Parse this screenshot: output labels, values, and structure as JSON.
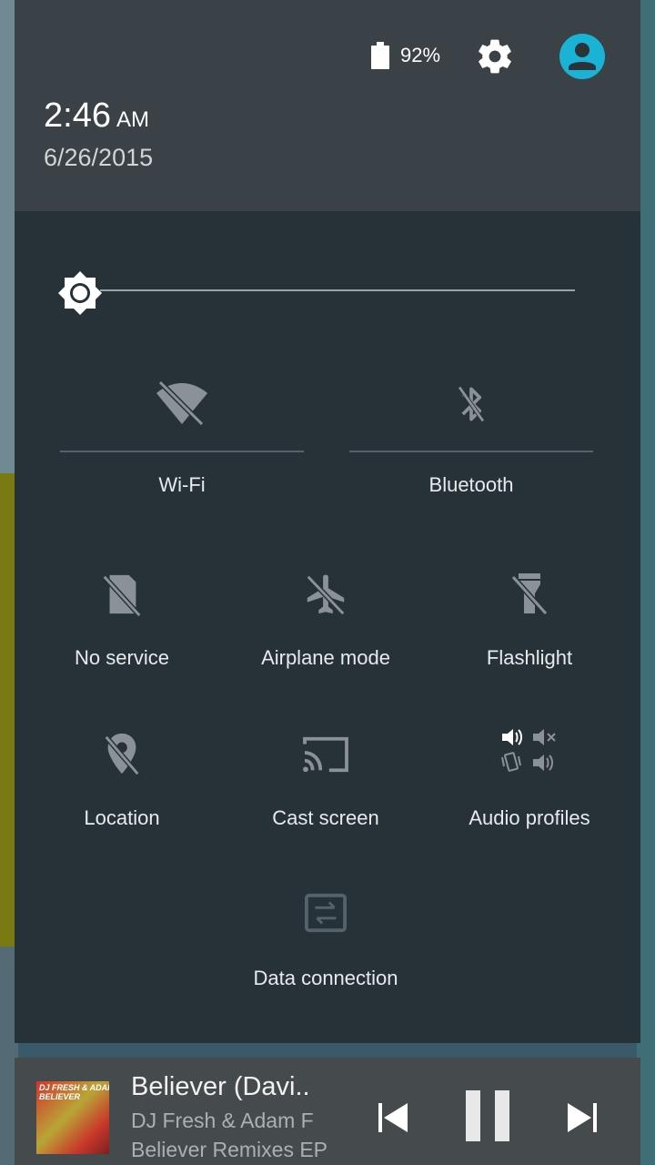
{
  "status": {
    "battery_percent": "92%"
  },
  "header": {
    "time": "2:46",
    "ampm": "AM",
    "date": "6/26/2015"
  },
  "quick_settings": {
    "brightness_level": 0.0,
    "large_tiles": [
      {
        "label": "Wi-Fi",
        "icon": "wifi-off-icon",
        "state": "off"
      },
      {
        "label": "Bluetooth",
        "icon": "bluetooth-off-icon",
        "state": "off"
      }
    ],
    "tiles": [
      {
        "label": "No service",
        "icon": "sim-off-icon"
      },
      {
        "label": "Airplane mode",
        "icon": "airplane-off-icon"
      },
      {
        "label": "Flashlight",
        "icon": "flashlight-off-icon"
      },
      {
        "label": "Location",
        "icon": "location-off-icon"
      },
      {
        "label": "Cast screen",
        "icon": "cast-icon"
      },
      {
        "label": "Audio profiles",
        "icon": "audio-profiles-icon"
      },
      {
        "label": "Data connection",
        "icon": "data-connection-icon"
      }
    ]
  },
  "media": {
    "album_art_text_1": "DJ FRESH & ADAM F",
    "album_art_text_2": "BELIEVER",
    "title": "Believer (Davi..",
    "artist": "DJ Fresh & Adam F",
    "album": "Believer Remixes EP"
  },
  "colors": {
    "header_bg": "#3a4147",
    "panel_bg": "#263238",
    "accent": "#1ab3d6",
    "media_bg": "#454a4d"
  }
}
